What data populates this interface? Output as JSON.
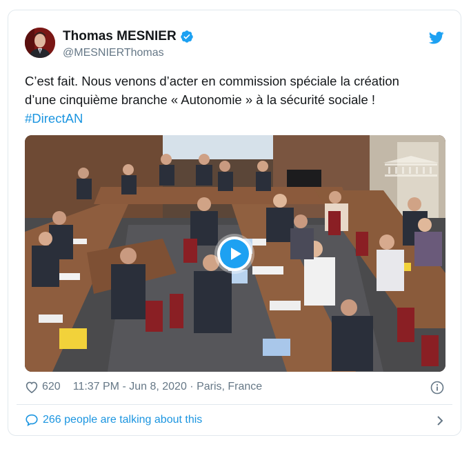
{
  "author": {
    "name": "Thomas MESNIER",
    "handle": "@MESNIERThomas",
    "verified": true
  },
  "tweet": {
    "text_line1": "C’est fait. Nous venons d’acter en commission spéciale la création",
    "text_line2": "d’une cinquième branche « Autonomie » à la sécurité sociale !",
    "hashtag": "#DirectAN"
  },
  "media": {
    "type": "video",
    "description_icon": "play-icon"
  },
  "meta": {
    "likes": "620",
    "time": "11:37 PM - Jun 8, 2020",
    "separator": " · ",
    "location": "Paris, France"
  },
  "conversation": {
    "label": "266 people are talking about this"
  },
  "colors": {
    "brand": "#1da1f2",
    "link": "#1b95e0",
    "muted": "#657786",
    "border": "#e1e8ed"
  },
  "icons": [
    "avatar",
    "verified-badge-icon",
    "twitter-bird-icon",
    "play-icon",
    "heart-icon",
    "info-icon",
    "comment-icon",
    "chevron-right-icon"
  ]
}
